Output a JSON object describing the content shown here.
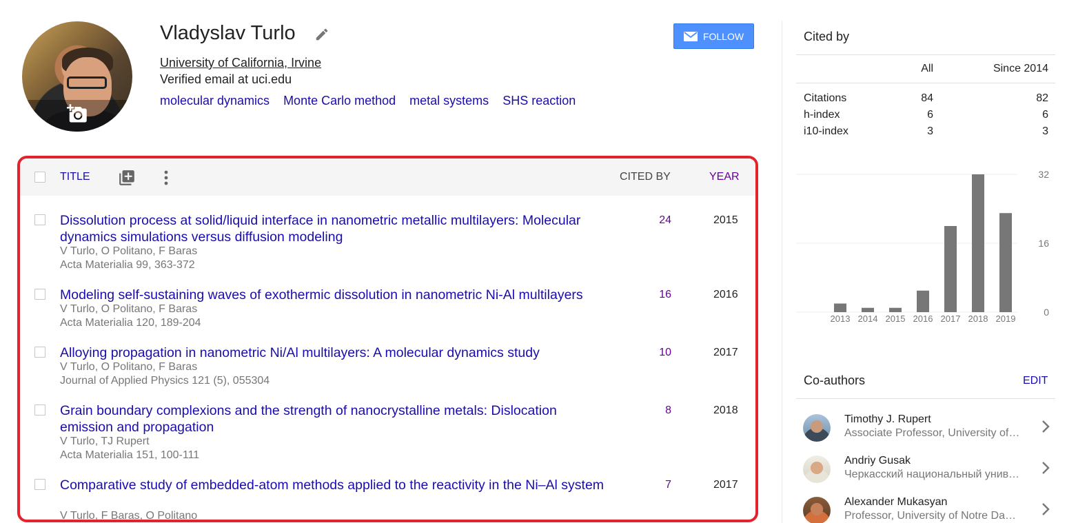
{
  "profile": {
    "name": "Vladyslav Turlo",
    "affiliation": "University of California, Irvine",
    "email": "Verified email at uci.edu",
    "interests": [
      "molecular dynamics",
      "Monte Carlo method",
      "metal systems",
      "SHS reaction"
    ],
    "follow_label": "FOLLOW",
    "accent": "#4d90fe",
    "icons": {
      "edit": "pencil-icon",
      "photo": "add-photo-icon",
      "follow": "envelope-icon"
    }
  },
  "table": {
    "headers": {
      "title": "TITLE",
      "cited_by": "CITED BY",
      "year": "YEAR"
    },
    "highlight_color": "#e2232b",
    "rows": [
      {
        "title": "Dissolution process at solid/liquid interface in nanometric metallic multilayers: Molecular dynamics simulations versus diffusion modeling",
        "authors": "V Turlo, O Politano, F Baras",
        "venue": "Acta Materialia 99, 363-372",
        "cited_by": "24",
        "year": "2015"
      },
      {
        "title": "Modeling self-sustaining waves of exothermic dissolution in nanometric Ni-Al multilayers",
        "authors": "V Turlo, O Politano, F Baras",
        "venue": "Acta Materialia 120, 189-204",
        "cited_by": "16",
        "year": "2016"
      },
      {
        "title": "Alloying propagation in nanometric Ni/Al multilayers: A molecular dynamics study",
        "authors": "V Turlo, O Politano, F Baras",
        "venue": "Journal of Applied Physics 121 (5), 055304",
        "cited_by": "10",
        "year": "2017"
      },
      {
        "title": "Grain boundary complexions and the strength of nanocrystalline metals: Dislocation emission and propagation",
        "authors": "V Turlo, TJ Rupert",
        "venue": "Acta Materialia 151, 100-111",
        "cited_by": "8",
        "year": "2018"
      },
      {
        "title": "Comparative study of embedded-atom methods applied to the reactivity in the Ni–Al system",
        "authors": "V Turlo, F Baras, O Politano",
        "venue": "",
        "cited_by": "7",
        "year": "2017"
      }
    ]
  },
  "cited_by": {
    "heading": "Cited by",
    "columns": [
      "All",
      "Since 2014"
    ],
    "stats": [
      {
        "label": "Citations",
        "all": "84",
        "since": "82"
      },
      {
        "label": "h-index",
        "all": "6",
        "since": "6"
      },
      {
        "label": "i10-index",
        "all": "3",
        "since": "3"
      }
    ]
  },
  "chart_data": {
    "type": "bar",
    "categories": [
      "2013",
      "2014",
      "2015",
      "2016",
      "2017",
      "2018",
      "2019"
    ],
    "values": [
      2,
      1,
      1,
      5,
      20,
      32,
      23
    ],
    "yticks": [
      "32",
      "16",
      "0"
    ],
    "ylim": [
      0,
      32
    ],
    "bar_color": "#777777",
    "grid": true
  },
  "coauthors": {
    "heading": "Co-authors",
    "edit_label": "EDIT",
    "items": [
      {
        "name": "Timothy J. Rupert",
        "affiliation": "Associate Professor, University of California, Irvine"
      },
      {
        "name": "Andriy Gusak",
        "affiliation": "Черкасский национальный университет"
      },
      {
        "name": "Alexander Mukasyan",
        "affiliation": "Professor, University of Notre Dame"
      }
    ]
  }
}
